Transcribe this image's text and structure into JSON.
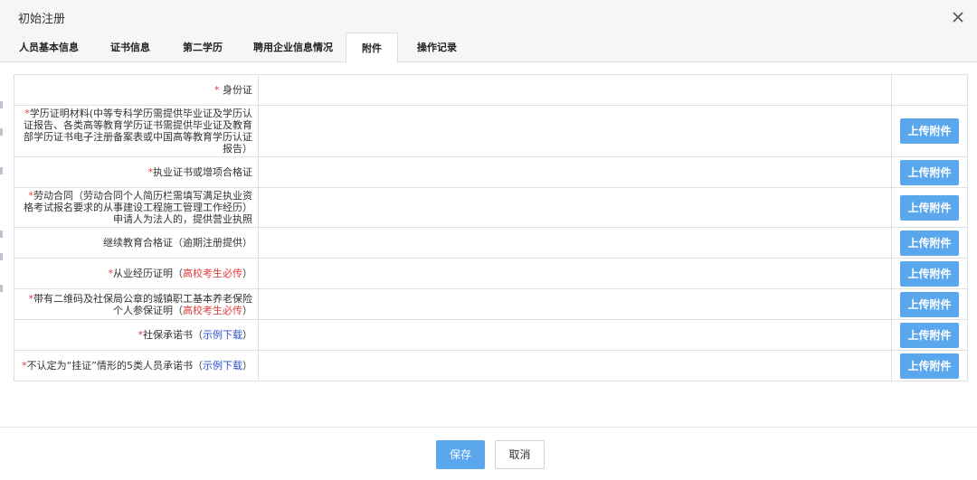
{
  "dialog": {
    "title": "初始注册"
  },
  "tabs": [
    {
      "label": "人员基本信息"
    },
    {
      "label": "证书信息"
    },
    {
      "label": "第二学历"
    },
    {
      "label": "聘用企业信息情况"
    },
    {
      "label": "附件",
      "active": true
    },
    {
      "label": "操作记录"
    }
  ],
  "rows": [
    {
      "required": "*",
      "label": "身份证",
      "extra": "",
      "link": "",
      "has_upload": false
    },
    {
      "required": "*",
      "label": "学历证明材料(中等专科学历需提供毕业证及学历认证报告、各类高等教育学历证书需提供毕业证及教育部学历证书电子注册备案表或中国高等教育学历认证报告）",
      "extra": "",
      "link": "",
      "has_upload": true
    },
    {
      "required": "*",
      "label": "执业证书或增项合格证",
      "extra": "",
      "link": "",
      "has_upload": true
    },
    {
      "required": "*",
      "label": "劳动合同（劳动合同个人简历栏需填写满足执业资格考试报名要求的从事建设工程施工管理工作经历）申请人为法人的，提供营业执照",
      "extra": "",
      "link": "",
      "has_upload": true
    },
    {
      "required": "",
      "label": "继续教育合格证（逾期注册提供）",
      "extra": "",
      "link": "",
      "has_upload": true
    },
    {
      "required": "*",
      "label": "从业经历证明（",
      "extra": "高校考生必传",
      "extra_close": "）",
      "link": "",
      "has_upload": true
    },
    {
      "required": "*",
      "label": "带有二维码及社保局公章的城镇职工基本养老保险个人参保证明（",
      "extra": "高校考生必传",
      "extra_close": "）",
      "link": "",
      "has_upload": true
    },
    {
      "required": "*",
      "label": "社保承诺书（",
      "extra": "",
      "link": "示例下载",
      "link_close": "）",
      "has_upload": true
    },
    {
      "required": "*",
      "label": "不认定为“挂证”情形的5类人员承诺书（",
      "extra": "",
      "link": "示例下载",
      "link_close": "）",
      "has_upload": true
    }
  ],
  "upload_label": "上传附件",
  "footer": {
    "save_label": "保存",
    "cancel_label": "取消"
  },
  "colors": {
    "primary": "#5aa7ee",
    "required": "#e23b3b",
    "link": "#2a4fcf"
  }
}
